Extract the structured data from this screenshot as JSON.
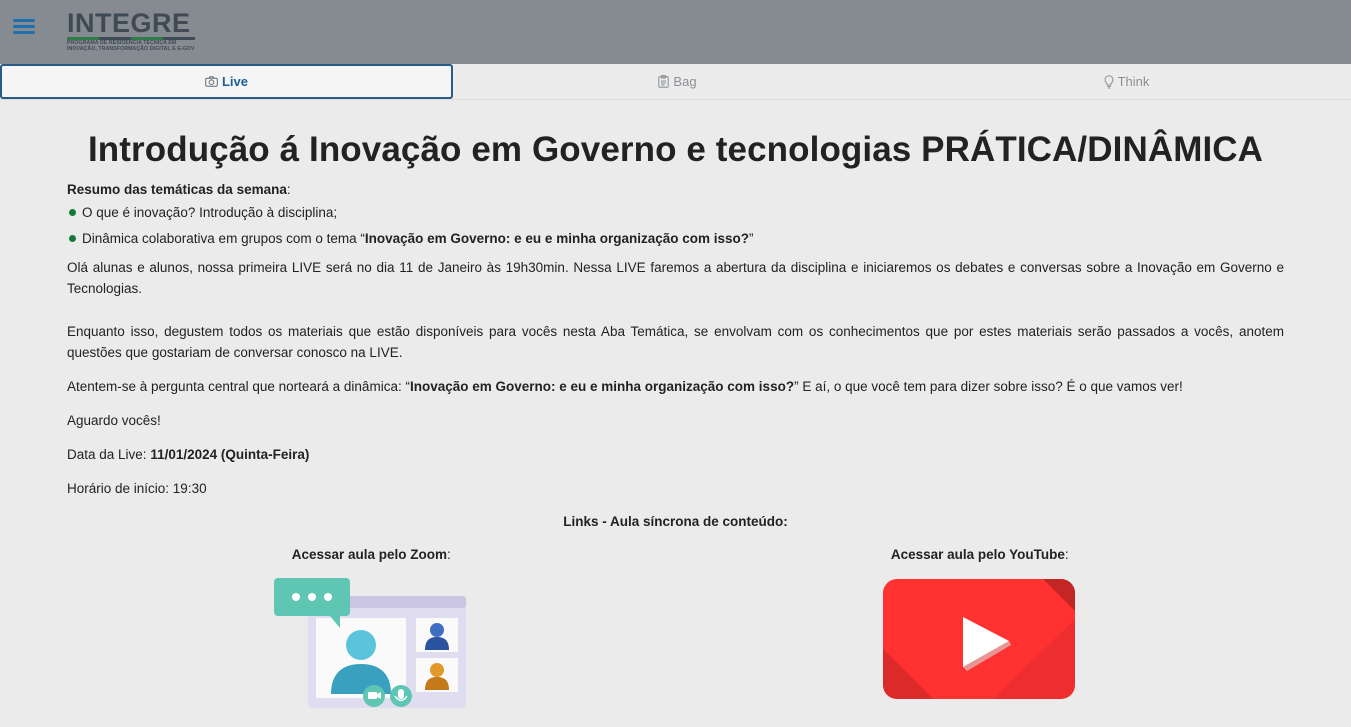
{
  "header": {
    "logo_word": "INTEGRE",
    "logo_subtitle_line1": "PROGRAMA DE RESIDÊNCIA TÉCNICA EM",
    "logo_subtitle_line2": "INOVAÇÃO, TRANSFORMAÇÃO DIGITAL E E-GOV",
    "menu_icon": "hamburger-menu-icon"
  },
  "tabs": [
    {
      "label": "Live",
      "icon": "camera-icon",
      "active": true
    },
    {
      "label": "Bag",
      "icon": "clipboard-icon",
      "active": false
    },
    {
      "label": "Think",
      "icon": "lightbulb-icon",
      "active": false
    }
  ],
  "main": {
    "title": "Introdução á Inovação em Governo e tecnologias PRÁTICA/DINÂMICA",
    "summary_label": "Resumo das temáticas da semana",
    "summary_colon": ":",
    "topics": [
      {
        "text": "O que é inovação? Introdução à disciplina;"
      },
      {
        "prefix": "Dinâmica colaborativa em grupos com o tema “",
        "bold": "Inovação em Governo: e eu e minha organização com isso?",
        "suffix": "”"
      }
    ],
    "paragraph1": "Olá alunas e alunos, nossa primeira LIVE será no dia 11 de Janeiro às 19h30min. Nessa LIVE faremos a abertura da disciplina e iniciaremos os debates e conversas sobre a Inovação em Governo e Tecnologias.",
    "paragraph2": "Enquanto isso, degustem todos os materiais que estão disponíveis para vocês nesta Aba Temática, se envolvam com os conhecimentos que por estes materiais serão passados a vocês, anotem questões que gostariam de conversar conosco na LIVE.",
    "paragraph3": {
      "prefix": "Atentem-se à pergunta central que norteará a dinâmica: “",
      "bold": "Inovação em Governo: e eu e minha organização com isso?",
      "suffix": "” E aí, o que você tem para dizer sobre isso? É o que vamos ver!"
    },
    "greeting": "Aguardo vocês!",
    "live_date_label": "Data da Live: ",
    "live_date_value": "11/01/2024 (Quinta-Feira)",
    "start_time": "Horário de início: 19:30",
    "links_title": "Links - Aula síncrona de conteúdo:",
    "zoom_label": "Acessar aula pelo Zoom",
    "youtube_label": "Acessar aula pelo YouTube",
    "label_colon": ":"
  },
  "colors": {
    "topbar": "#858b91",
    "accent_blue": "#1f5e93",
    "bullet_green": "#137a3a",
    "youtube_red": "#ff3131",
    "zoom_teal": "#5ec6b3"
  }
}
